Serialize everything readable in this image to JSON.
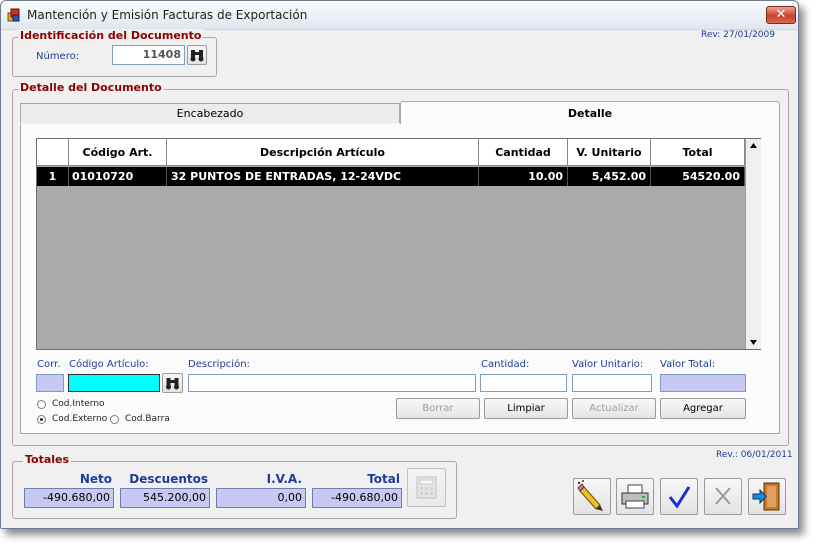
{
  "window": {
    "title": "Mantención y Emisión Facturas de Exportación",
    "close_label": "✕"
  },
  "revision_top": "Rev: 27/01/2009",
  "revision_bottom": "Rev.: 06/01/2011",
  "identificacion": {
    "legend": "Identificación del Documento",
    "numero_label": "Número:",
    "numero_value": "11408"
  },
  "detalle": {
    "legend": "Detalle del Documento",
    "tabs": [
      {
        "label": "Encabezado",
        "active": false
      },
      {
        "label": "Detalle",
        "active": true
      }
    ],
    "table": {
      "columns": [
        "",
        "Código Art.",
        "Descripción Artículo",
        "Cantidad",
        "V. Unitario",
        "Total"
      ],
      "rows": [
        {
          "corr": "1",
          "codigo": "01010720",
          "descripcion": "32 PUNTOS DE ENTRADAS, 12-24VDC",
          "cantidad": "10.00",
          "unitario": "5,452.00",
          "total": "54520.00"
        }
      ]
    },
    "form": {
      "corr_label": "Corr.",
      "codigo_label": "Código Artículo:",
      "descripcion_label": "Descripción:",
      "cantidad_label": "Cantidad:",
      "unitario_label": "Valor Unitario:",
      "total_label": "Valor Total:",
      "radios": [
        {
          "label": "Cod.Interno",
          "checked": false
        },
        {
          "label": "Cod.Externo",
          "checked": true
        },
        {
          "label": "Cod.Barra",
          "checked": false
        }
      ],
      "buttons": {
        "borrar": "Borrar",
        "limpiar": "Limpiar",
        "actualizar": "Actualizar",
        "agregar": "Agregar"
      }
    }
  },
  "totales": {
    "legend": "Totales",
    "neto_label": "Neto",
    "neto_value": "-490.680,00",
    "descuentos_label": "Descuentos",
    "descuentos_value": "545.200,00",
    "iva_label": "I.V.A.",
    "iva_value": "0,00",
    "total_label": "Total",
    "total_value": "-490.680,00"
  },
  "colors": {
    "accent_label": "#1f3c9a",
    "legend_red": "#8b0000",
    "codigo_input": "#00ffff",
    "readonly_field": "#c8c8f4"
  }
}
